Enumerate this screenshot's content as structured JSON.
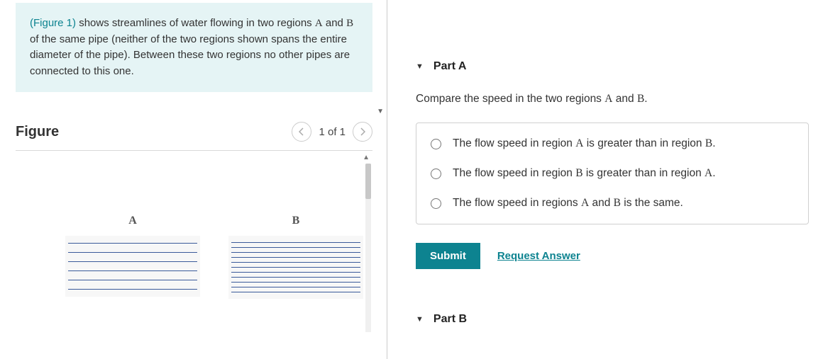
{
  "problem": {
    "figure_link_text": "(Figure 1)",
    "text_rest": " shows streamlines of water flowing in two regions ",
    "region_a": "A",
    "mid1": " and ",
    "region_b": "B",
    "mid2": " of the same pipe (neither of the two regions shown spans the entire diameter of the pipe). Between these two regions no other pipes are connected to this one."
  },
  "figure": {
    "title": "Figure",
    "pager": "1 of 1",
    "label_a": "A",
    "label_b": "B"
  },
  "partA": {
    "title": "Part A",
    "prompt_pre": "Compare the speed in the two regions ",
    "prompt_a": "A",
    "prompt_mid": " and ",
    "prompt_b": "B",
    "prompt_post": ".",
    "choices": [
      {
        "pre": "The flow speed in region ",
        "r1": "A",
        "mid": " is greater than in region ",
        "r2": "B",
        "post": "."
      },
      {
        "pre": "The flow speed in region ",
        "r1": "B",
        "mid": " is greater than in region ",
        "r2": "A",
        "post": "."
      },
      {
        "pre": "The flow speed in regions ",
        "r1": "A",
        "mid": " and ",
        "r2": "B",
        "post": " is the same."
      }
    ],
    "submit": "Submit",
    "request": "Request Answer"
  },
  "partB": {
    "title": "Part B"
  }
}
